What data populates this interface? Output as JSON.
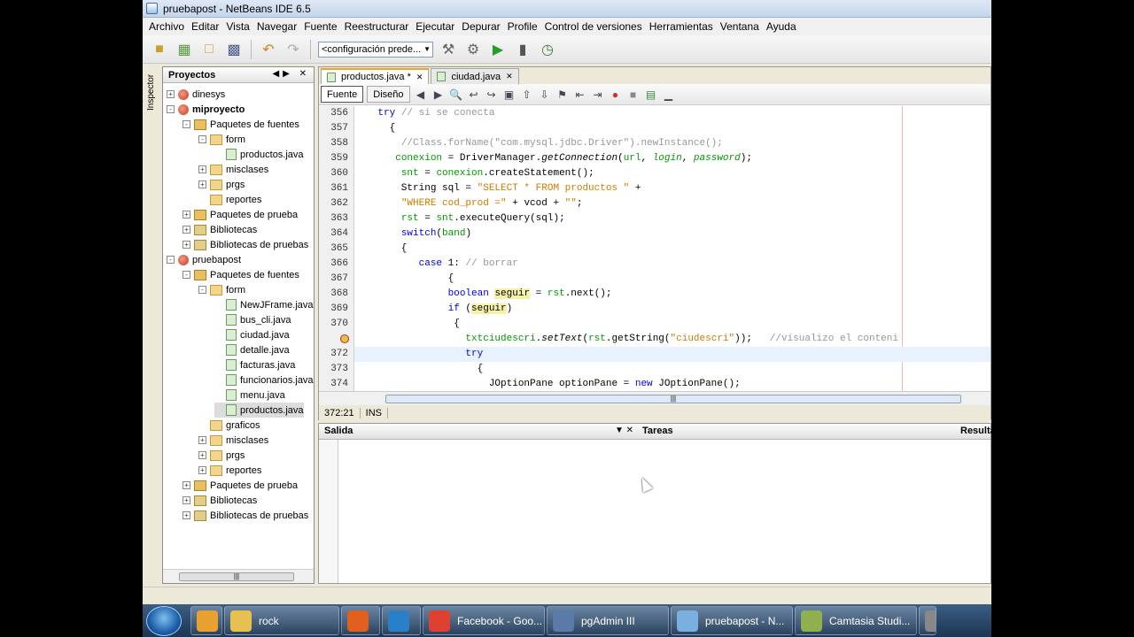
{
  "window": {
    "title": "pruebapost - NetBeans IDE 6.5"
  },
  "menu": [
    "Archivo",
    "Editar",
    "Vista",
    "Navegar",
    "Fuente",
    "Reestructurar",
    "Ejecutar",
    "Depurar",
    "Profile",
    "Control de versiones",
    "Herramientas",
    "Ventana",
    "Ayuda"
  ],
  "toolbar": {
    "config_value": "<configuración prede..."
  },
  "inspector_label": "Inspector",
  "projects": {
    "title": "Proyectos",
    "tree": [
      {
        "label": "dinesys",
        "level": 0,
        "icon": "project-icon",
        "expand": "+",
        "bold": false
      },
      {
        "label": "miproyecto",
        "level": 0,
        "icon": "project-icon",
        "expand": "-",
        "bold": true
      },
      {
        "label": "Paquetes de fuentes",
        "level": 1,
        "icon": "source-packages-icon",
        "expand": "-"
      },
      {
        "label": "form",
        "level": 2,
        "icon": "package-icon",
        "expand": "-"
      },
      {
        "label": "productos.java",
        "level": 3,
        "icon": "java-file-icon",
        "expand": ""
      },
      {
        "label": "misclases",
        "level": 2,
        "icon": "package-icon",
        "expand": "+"
      },
      {
        "label": "prgs",
        "level": 2,
        "icon": "package-icon",
        "expand": "+"
      },
      {
        "label": "reportes",
        "level": 2,
        "icon": "package-icon",
        "expand": ""
      },
      {
        "label": "Paquetes de prueba",
        "level": 1,
        "icon": "test-packages-icon",
        "expand": "+"
      },
      {
        "label": "Bibliotecas",
        "level": 1,
        "icon": "libraries-icon",
        "expand": "+"
      },
      {
        "label": "Bibliotecas de pruebas",
        "level": 1,
        "icon": "libraries-icon",
        "expand": "+"
      },
      {
        "label": "pruebapost",
        "level": 0,
        "icon": "project-icon",
        "expand": "-"
      },
      {
        "label": "Paquetes de fuentes",
        "level": 1,
        "icon": "source-packages-icon",
        "expand": "-"
      },
      {
        "label": "form",
        "level": 2,
        "icon": "package-icon",
        "expand": "-"
      },
      {
        "label": "NewJFrame.java",
        "level": 3,
        "icon": "java-file-icon",
        "expand": ""
      },
      {
        "label": "bus_cli.java",
        "level": 3,
        "icon": "java-file-icon",
        "expand": ""
      },
      {
        "label": "ciudad.java",
        "level": 3,
        "icon": "java-file-icon",
        "expand": ""
      },
      {
        "label": "detalle.java",
        "level": 3,
        "icon": "java-file-icon",
        "expand": ""
      },
      {
        "label": "facturas.java",
        "level": 3,
        "icon": "java-file-icon",
        "expand": ""
      },
      {
        "label": "funcionarios.java",
        "level": 3,
        "icon": "java-file-icon",
        "expand": ""
      },
      {
        "label": "menu.java",
        "level": 3,
        "icon": "java-file-icon",
        "expand": ""
      },
      {
        "label": "productos.java",
        "level": 3,
        "icon": "java-file-icon",
        "expand": "",
        "selected": true
      },
      {
        "label": "graficos",
        "level": 2,
        "icon": "package-icon",
        "expand": ""
      },
      {
        "label": "misclases",
        "level": 2,
        "icon": "package-icon",
        "expand": "+"
      },
      {
        "label": "prgs",
        "level": 2,
        "icon": "package-icon",
        "expand": "+"
      },
      {
        "label": "reportes",
        "level": 2,
        "icon": "package-icon",
        "expand": "+"
      },
      {
        "label": "Paquetes de prueba",
        "level": 1,
        "icon": "test-packages-icon",
        "expand": "+"
      },
      {
        "label": "Bibliotecas",
        "level": 1,
        "icon": "libraries-icon",
        "expand": "+"
      },
      {
        "label": "Bibliotecas de pruebas",
        "level": 1,
        "icon": "libraries-icon",
        "expand": "+"
      }
    ]
  },
  "editor": {
    "tabs": [
      {
        "label": "productos.java *",
        "active": true
      },
      {
        "label": "ciudad.java",
        "active": false
      }
    ],
    "views": {
      "source": "Fuente",
      "design": "Diseño"
    },
    "lines": [
      {
        "n": "356",
        "html": "    <span class='kw'>try</span> <span class='cm'>// si se conecta</span>"
      },
      {
        "n": "357",
        "html": "      {"
      },
      {
        "n": "358",
        "html": "        <span class='cm'>//Class.forName(\"com.mysql.jdbc.Driver\").newInstance();</span>"
      },
      {
        "n": "359",
        "html": "       <span class='fd'>conexion</span> = DriverManager.<span class='it'>getConnection</span>(<span class='fd'>url</span>, <span class='fd it'>login</span>, <span class='fd it'>password</span>);"
      },
      {
        "n": "360",
        "html": "        <span class='fd'>snt</span> = <span class='fd'>conexion</span>.createStatement();"
      },
      {
        "n": "361",
        "html": "        String sql = <span class='st'>\"SELECT * FROM productos \"</span> +"
      },
      {
        "n": "362",
        "html": "        <span class='st'>\"WHERE cod_prod =\"</span> + vcod + <span class='st'>\"\"</span>;"
      },
      {
        "n": "363",
        "html": "        <span class='fd'>rst</span> = <span class='fd'>snt</span>.executeQuery(sql);"
      },
      {
        "n": "364",
        "html": "        <span class='kw'>switch</span>(<span class='fd'>band</span>)"
      },
      {
        "n": "365",
        "html": "        {"
      },
      {
        "n": "366",
        "html": "           <span class='kw'>case</span> 1: <span class='cm'>// borrar</span>"
      },
      {
        "n": "367",
        "html": "                {"
      },
      {
        "n": "368",
        "html": "                <span class='kw'>boolean</span> <span class='hl'>seguir</span> = <span class='fd'>rst</span>.next();"
      },
      {
        "n": "369",
        "html": "                <span class='kw'>if</span> (<span class='hl'>seguir</span>)"
      },
      {
        "n": "370",
        "html": "                 {"
      },
      {
        "n": "",
        "html": "                   <span class='fd'>txtciudescri</span>.<span class='it'>setText</span>(<span class='fd'>rst</span>.getString(<span class='st'>\"ciudescri\"</span>));   <span class='cm'>//visualizo el conteni</span>",
        "marker": true
      },
      {
        "n": "372",
        "html": "                   <span class='kw'>try</span>",
        "current": true
      },
      {
        "n": "373",
        "html": "                     {"
      },
      {
        "n": "374",
        "html": "                       JOptionPane optionPane = <span class='kw'>new</span> JOptionPane();"
      }
    ],
    "status": {
      "position": "372:21",
      "mode": "INS"
    }
  },
  "output": {
    "tabs": [
      "Salida",
      "Tareas",
      "Resulta"
    ]
  },
  "taskbar": [
    {
      "label": "",
      "color": "#e8a030",
      "w": 36
    },
    {
      "label": "rock",
      "color": "#e8c050",
      "w": 130
    },
    {
      "label": "",
      "color": "#e06020",
      "w": 44
    },
    {
      "label": "",
      "color": "#2a80c8",
      "w": 44
    },
    {
      "label": "Facebook - Goo...",
      "color": "#e04030",
      "w": 138
    },
    {
      "label": "pgAdmin III",
      "color": "#5a7aa8",
      "w": 138
    },
    {
      "label": "pruebapost - N...",
      "color": "#7ab0e0",
      "w": 138
    },
    {
      "label": "Camtasia Studi...",
      "color": "#90b050",
      "w": 138
    },
    {
      "label": "",
      "color": "#888888",
      "w": 20
    }
  ]
}
